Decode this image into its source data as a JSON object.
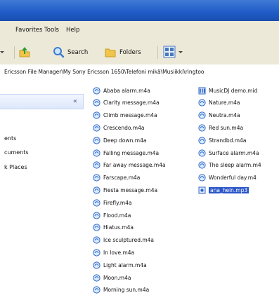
{
  "menu": {
    "favorites": "Favorites",
    "tools": "Tools",
    "help": "Help"
  },
  "toolbar": {
    "search": "Search",
    "folders": "Folders"
  },
  "address": "Ericsson File Manager\\My Sony Ericsson 1650\\Telefoni mikä\\Musiikki\\ringtoo",
  "taskpane": {
    "collapse_glyph": "«",
    "items": [
      "ents",
      "cuments",
      "k Places"
    ]
  },
  "files": {
    "col1": [
      "Ababa alarm.m4a",
      "Clarity message.m4a",
      "Climb message.m4a",
      "Crescendo.m4a",
      "Deep down.m4a",
      "Falling message.m4a",
      "Far away message.m4a",
      "Farscape.m4a",
      "Fiesta message.m4a",
      "Firefly.m4a",
      "Flood.m4a",
      "Hiatus.m4a",
      "Ice sculptured.m4a",
      "In love.m4a",
      "Light alarm.m4a",
      "Moon.m4a",
      "Morning sun.m4a"
    ],
    "col2": [
      "MusicDJ demo.mid",
      "Nature.m4a",
      "Neutra.m4a",
      "Red sun.m4a",
      "Strandbd.m4a",
      "Surface alarm.m4a",
      "The sleep alarm.m4",
      "Wonderful day.m4",
      "ana_hein.mp3"
    ],
    "selected_col2_index": 8
  },
  "colors": {
    "title_blue": "#1f5bc6",
    "selection_blue": "#2b56c8",
    "chrome": "#ece9d8"
  }
}
